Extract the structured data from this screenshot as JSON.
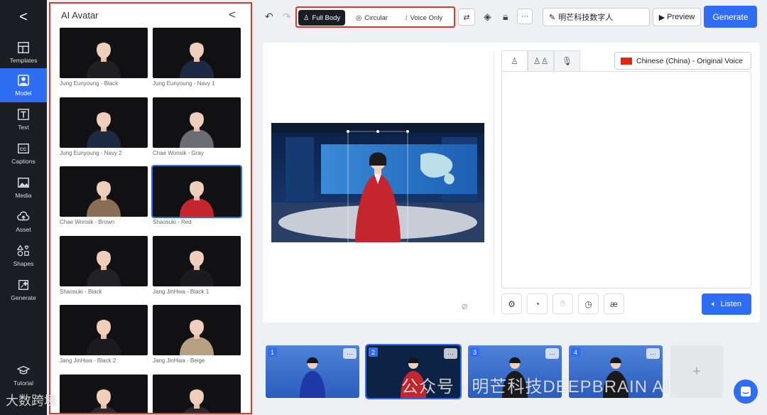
{
  "rail": {
    "back_label": "<",
    "items": [
      {
        "label": "Templates",
        "icon": "templates-icon"
      },
      {
        "label": "Model",
        "icon": "model-icon"
      },
      {
        "label": "Text",
        "icon": "text-icon"
      },
      {
        "label": "Captions",
        "icon": "captions-icon"
      },
      {
        "label": "Media",
        "icon": "media-icon"
      },
      {
        "label": "Asset",
        "icon": "asset-icon"
      },
      {
        "label": "Shapes",
        "icon": "shapes-icon"
      },
      {
        "label": "Generate",
        "icon": "generate-icon"
      }
    ],
    "tutorial_label": "Tutorial"
  },
  "panel": {
    "title": "AI Avatar",
    "close_label": "<",
    "avatars": [
      {
        "label": "Jung Eunyoung - Black",
        "suit": "#1f1f22"
      },
      {
        "label": "Jung Eunyoung - Navy 1",
        "suit": "#1e2a44"
      },
      {
        "label": "Jung Eunyoung - Navy 2",
        "suit": "#1e2a44"
      },
      {
        "label": "Chae Wonsik - Gray",
        "suit": "#6a6d73"
      },
      {
        "label": "Chae Wonsik - Brown",
        "suit": "#8a6d55"
      },
      {
        "label": "Shaosuki - Red",
        "suit": "#c3262f"
      },
      {
        "label": "Shaosuki - Black",
        "suit": "#222225"
      },
      {
        "label": "Jang JinHwa - Black 1",
        "suit": "#1c1c1f"
      },
      {
        "label": "Jang JinHwa - Black 2",
        "suit": "#1c1c1f"
      },
      {
        "label": "Jang JinHwa - Beige",
        "suit": "#b79f82"
      },
      {
        "label": "",
        "suit": "#2a2a2d"
      },
      {
        "label": "",
        "suit": "#2a2a2d"
      }
    ],
    "selected_index": 5
  },
  "toolbar": {
    "modes": [
      "Full Body",
      "Circular",
      "Voice Only"
    ],
    "active_mode": "Full Body",
    "more_label": "···",
    "project_name": "明芒科技数字人",
    "preview_label": "Preview",
    "generate_label": "Generate"
  },
  "script": {
    "voice": "Chinese (China) - Original Voice",
    "tools": [
      "ai-icon",
      "speed-icon",
      "gesture-icon",
      "pause-icon",
      "phoneme-icon"
    ],
    "phoneme_label": "æ",
    "listen_label": "Listen"
  },
  "scenes": [
    {
      "num": "1",
      "more": "···",
      "suit": "#1f3aa8"
    },
    {
      "num": "2",
      "more": "···",
      "suit": "#c3262f"
    },
    {
      "num": "3",
      "more": "···",
      "suit": "#1a1a1d"
    },
    {
      "num": "4",
      "more": "···",
      "suit": "#1a1a1d"
    }
  ],
  "add_scene_label": "+",
  "watermarks": {
    "center": "公众号 · 明芒科技DEEPBRAIN AI",
    "corner": "大数跨境"
  },
  "colors": {
    "accent": "#2f6ef3",
    "highlight": "#e0352b",
    "rail": "#1c1d22"
  }
}
